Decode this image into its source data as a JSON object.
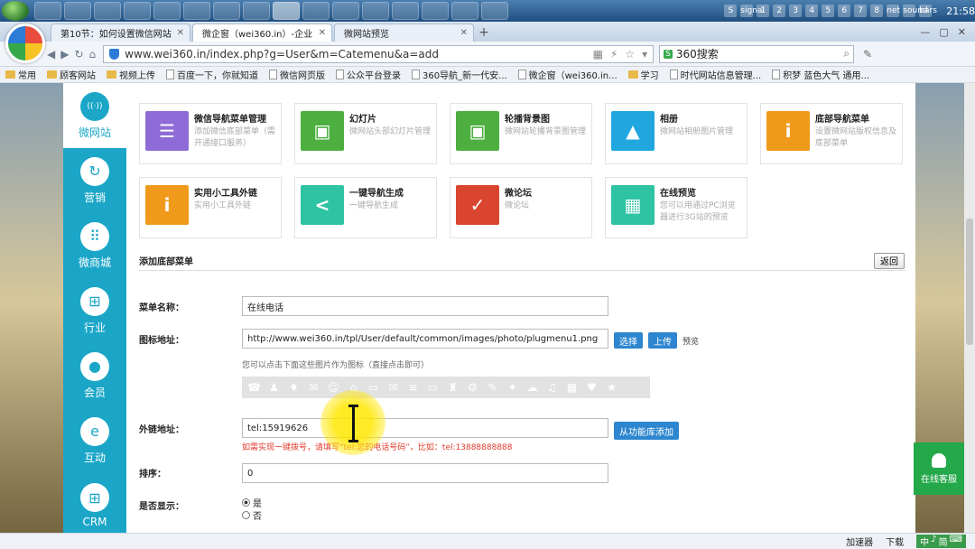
{
  "taskbar": {
    "clock": "21:58",
    "pinned": [
      "media",
      "app",
      "chat",
      "bag",
      "record",
      "close",
      "ps",
      "photo",
      "browser",
      "power",
      "pen",
      "mail",
      "360",
      "folder",
      "tools",
      "flag"
    ],
    "tray": [
      "S",
      "signal",
      "1",
      "2",
      "3",
      "4",
      "5",
      "6",
      "7",
      "8",
      "net",
      "sound",
      "bars"
    ]
  },
  "browser": {
    "tabs": [
      {
        "label": "第10节：如何设置微信网站",
        "active": false
      },
      {
        "label": "微企窗（wei360.in）-企业",
        "active": true
      },
      {
        "label": "微网站预览",
        "active": false
      }
    ],
    "new_tab": "+",
    "url": "www.wei360.in/index.php?g=User&m=Catemenu&a=add",
    "search_badge": "S",
    "search_placeholder": "360搜索",
    "bookmarks": [
      "常用",
      "顾客网站",
      "视频上传",
      "百度一下，你就知道",
      "微信网页版",
      "公众平台登录",
      "360导航_新一代安...",
      "微企窗（wei360.in...",
      "学习",
      "时代网站信息管理...",
      "积梦 蓝色大气 通用..."
    ]
  },
  "sidebar": {
    "items": [
      {
        "label": "微网站",
        "icon": "wifi",
        "active": true
      },
      {
        "label": "营销",
        "icon": "refresh",
        "active": false
      },
      {
        "label": "微商城",
        "icon": "grid",
        "active": false
      },
      {
        "label": "行业",
        "icon": "windows",
        "active": false
      },
      {
        "label": "会员",
        "icon": "user",
        "active": false
      },
      {
        "label": "互动",
        "icon": "ie",
        "active": false
      },
      {
        "label": "CRM",
        "icon": "apps",
        "active": false
      }
    ]
  },
  "cards": [
    {
      "title": "微信导航菜单管理",
      "desc": "添加微信底部菜单（需开通接口服务）",
      "color": "#8e6bd6",
      "glyph": "☰"
    },
    {
      "title": "幻灯片",
      "desc": "微网站头部幻灯片管理",
      "color": "#4caf3f",
      "glyph": "▣"
    },
    {
      "title": "轮播背景图",
      "desc": "微网站轮播背景图管理",
      "color": "#4caf3f",
      "glyph": "▣"
    },
    {
      "title": "相册",
      "desc": "微网站相册图片管理",
      "color": "#21a7e0",
      "glyph": "▲"
    },
    {
      "title": "底部导航菜单",
      "desc": "设置微网站版权信息及底部菜单",
      "color": "#f09a1c",
      "glyph": "i"
    },
    {
      "title": "实用小工具外链",
      "desc": "实用小工具外链",
      "color": "#f09a1c",
      "glyph": "i"
    },
    {
      "title": "一键导航生成",
      "desc": "一键导航生成",
      "color": "#2ec3a3",
      "glyph": "<"
    },
    {
      "title": "微论坛",
      "desc": "微论坛",
      "color": "#d9452f",
      "glyph": "✓"
    },
    {
      "title": "在线预览",
      "desc": "您可以用通过PC浏览器进行3G站的预览",
      "color": "#2ec3a3",
      "glyph": "▦"
    }
  ],
  "form": {
    "section_title": "添加底部菜单",
    "back_label": "返回",
    "name_label": "菜单名称：",
    "name_value": "在线电话",
    "icon_label": "图标地址：",
    "icon_value": "http://www.wei360.in/tpl/User/default/common/images/photo/plugmenu1.png",
    "select_label": "选择",
    "upload_label": "上传",
    "preview_label": "预览",
    "icon_hint": "您可以点击下面这些图片作为图标（直接点击即可）",
    "icon_glyphs": [
      "☎",
      "♟",
      "♦",
      "✉",
      "☺",
      "⌂",
      "▭",
      "✉",
      "≡",
      "▭",
      "♜",
      "⚙",
      "✎",
      "✦",
      "☁",
      "♫",
      "▦",
      "♥",
      "★"
    ],
    "link_label": "外链地址：",
    "link_value": "tel:15919626",
    "link_button": "从功能库添加",
    "link_hint": "如需实现一键拨号，请填写“tel:您的电话号码”，比如：tel:13888888888",
    "sort_label": "排序：",
    "sort_value": "0",
    "show_label": "是否显示：",
    "show_yes": "是",
    "show_no": "否"
  },
  "kefu": {
    "label": "在线客服"
  },
  "statusbar": {
    "accelerator": "加速器",
    "download": "下载",
    "ime": [
      "中",
      "♪",
      "简",
      "⌨"
    ]
  }
}
